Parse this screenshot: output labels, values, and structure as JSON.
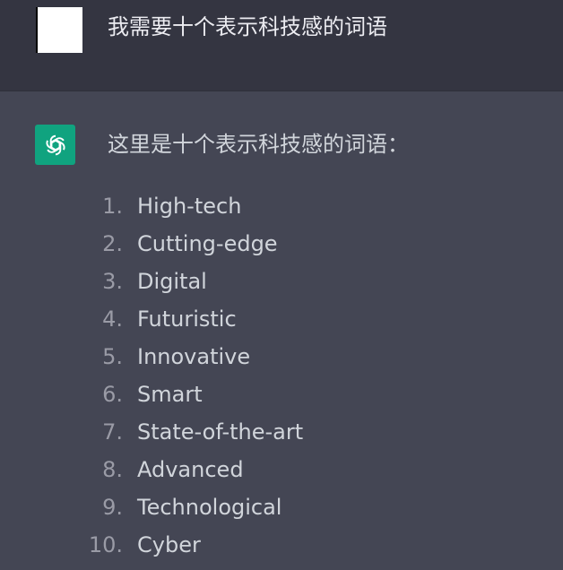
{
  "conversation": {
    "user": {
      "message": "我需要十个表示科技感的词语"
    },
    "assistant": {
      "icon": "openai-logo-icon",
      "accent": "#10a37f",
      "intro": "这里是十个表示科技感的词语：",
      "items": [
        {
          "num": "1.",
          "text": "High-tech"
        },
        {
          "num": "2.",
          "text": "Cutting-edge"
        },
        {
          "num": "3.",
          "text": "Digital"
        },
        {
          "num": "4.",
          "text": "Futuristic"
        },
        {
          "num": "5.",
          "text": "Innovative"
        },
        {
          "num": "6.",
          "text": "Smart"
        },
        {
          "num": "7.",
          "text": "State-of-the-art"
        },
        {
          "num": "8.",
          "text": "Advanced"
        },
        {
          "num": "9.",
          "text": "Technological"
        },
        {
          "num": "10.",
          "text": "Cyber"
        }
      ]
    }
  }
}
